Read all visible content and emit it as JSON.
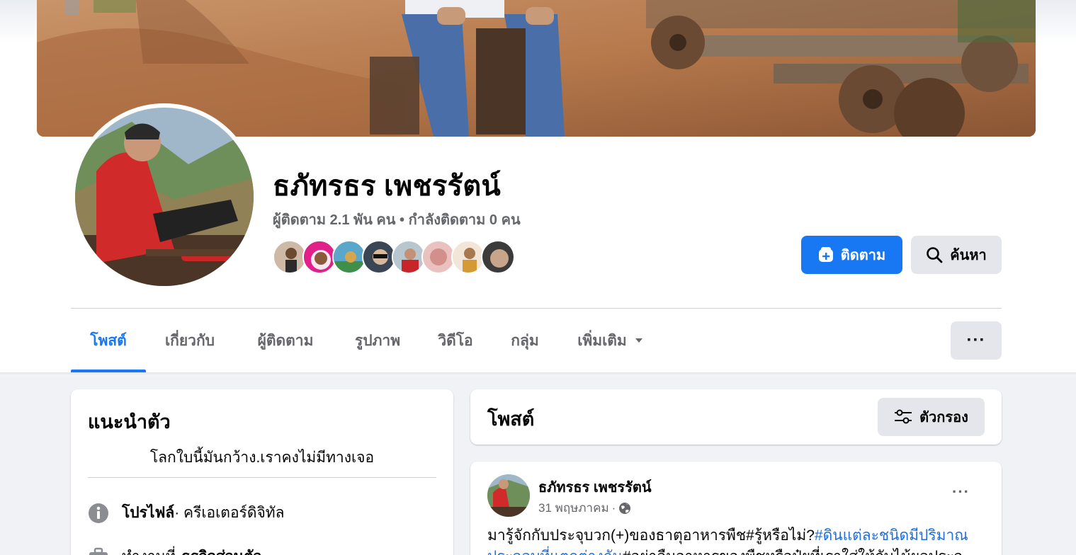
{
  "profile": {
    "name": "ธภัทรธร เพชรรัตน์",
    "followers_text": "ผู้ติดตาม 2.1 พัน คน",
    "separator": " • ",
    "following_text": "กำลังติดตาม 0 คน",
    "follower_avatar_count": 8
  },
  "actions": {
    "follow_label": "ติดตาม",
    "search_label": "ค้นหา",
    "more_label": "···"
  },
  "tabs": [
    {
      "label": "โพสต์",
      "active": true
    },
    {
      "label": "เกี่ยวกับ",
      "active": false
    },
    {
      "label": "ผู้ติดตาม",
      "active": false
    },
    {
      "label": "รูปภาพ",
      "active": false
    },
    {
      "label": "วิดีโอ",
      "active": false
    },
    {
      "label": "กลุ่ม",
      "active": false
    },
    {
      "label": "เพิ่มเติม",
      "active": false
    }
  ],
  "intro": {
    "title": "แนะนำตัว",
    "bio": "โลกใบนี้มันกว้าง.เราคงไม่มีทางเจอ",
    "profile_label": "โปรไฟล์",
    "profile_value": " · ครีเอเตอร์ดิจิทัล",
    "work_label": "ทำงานที่",
    "work_value": "ธรกิจส่วนตัว"
  },
  "posts": {
    "title": "โพสต์",
    "filter_label": "ตัวกรอง",
    "menu_label": "···",
    "items": [
      {
        "author": "ธภัทรธร เพชรรัตน์",
        "date": "31 พฤษภาคม",
        "meta_sep": " · ",
        "text_plain": "มารู้จักกับประจุบวก(+)ของธาตุอาหารพืช#รู้หรือไม่?",
        "text_hash1": "#ดินแต่ละชนิดมีปริมาณประจุลบที่แตกต่างกัน",
        "text_plain2": "#อย่าลืมอาหารของพืชหรือปุ๋ยที่เราใส่ให้กับไม้ผลประจ"
      }
    ]
  },
  "colors": {
    "accent": "#1877f2",
    "page_bg": "#f0f2f5",
    "secondary_text": "#65676b",
    "button_gray": "#e4e6eb",
    "hashtag": "#216fdb"
  },
  "icons": {
    "follow": "follow-plus-icon",
    "search": "search-icon",
    "filter": "filter-sliders-icon",
    "info": "info-icon",
    "work": "briefcase-icon",
    "privacy": "globe-icon",
    "dropdown": "caret-down-icon"
  }
}
